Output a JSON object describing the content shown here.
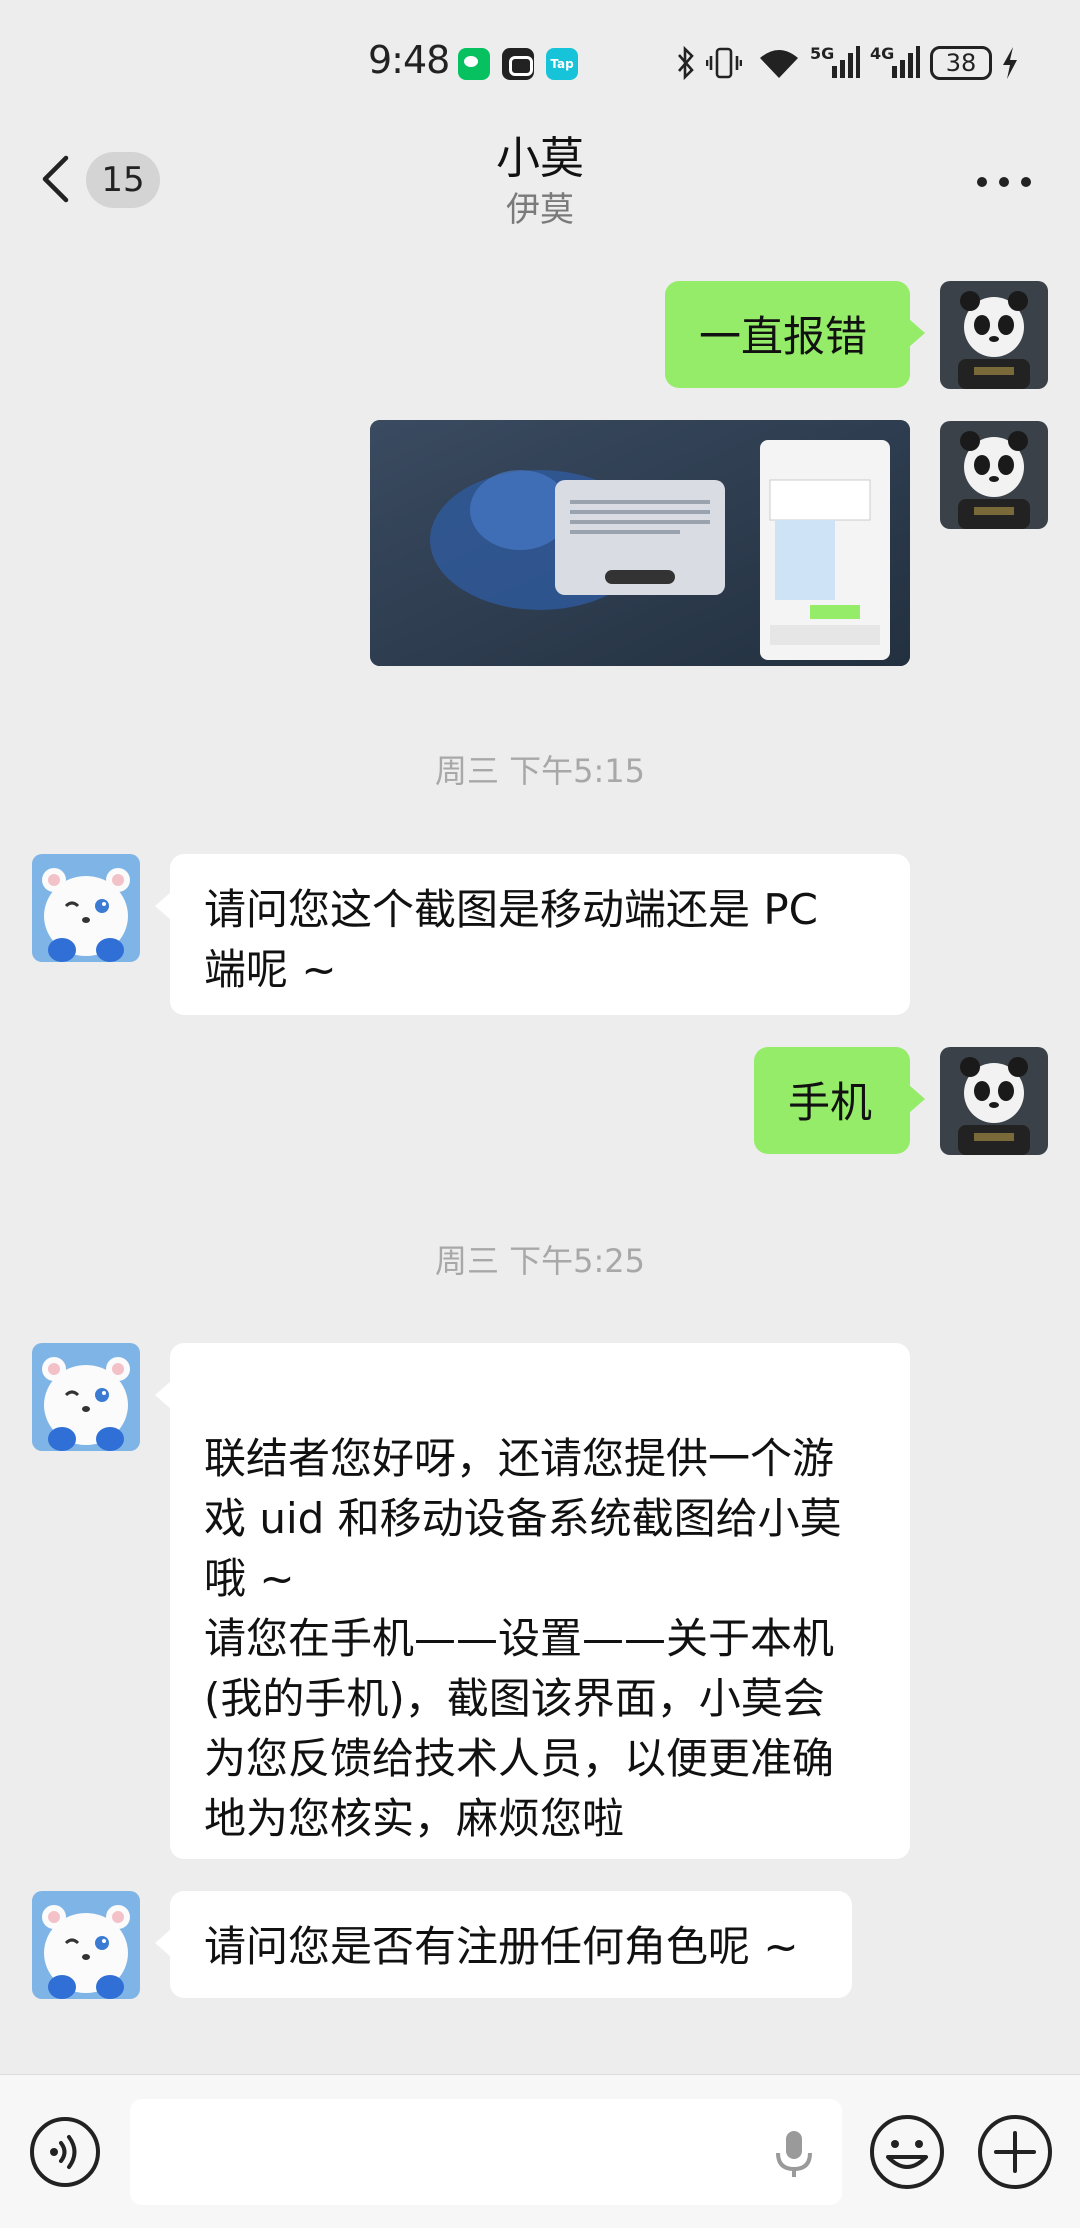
{
  "status_bar": {
    "time": "9:48",
    "battery": "38",
    "network_1": "5G",
    "network_2": "4G"
  },
  "header": {
    "unread_count": "15",
    "title": "小莫",
    "subtitle": "伊莫"
  },
  "messages": [
    {
      "sender": "me",
      "type": "text",
      "text": "一直报错"
    },
    {
      "sender": "me",
      "type": "image",
      "description_icon": "screenshot-thumbnail"
    },
    {
      "type": "timestamp",
      "text": "周三 下午5:15"
    },
    {
      "sender": "other",
      "type": "text",
      "text": "请问您这个截图是移动端还是 PC\n端呢 ~"
    },
    {
      "sender": "me",
      "type": "text",
      "text": "手机"
    },
    {
      "type": "timestamp",
      "text": "周三 下午5:25"
    },
    {
      "sender": "other",
      "type": "text",
      "text": "\n联结者您好呀，还请您提供一个游\n戏 uid 和移动设备系统截图给小莫\n哦 ~\n请您在手机——设置——关于本机\n(我的手机)，截图该界面，小莫会\n为您反馈给技术人员，以便更准确\n地为您核实，麻烦您啦"
    },
    {
      "sender": "other",
      "type": "text",
      "text": "请问您是否有注册任何角色呢 ~"
    }
  ],
  "input_bar": {
    "placeholder": ""
  },
  "colors": {
    "background": "#ededed",
    "my_bubble": "#95ec69",
    "their_bubble": "#ffffff",
    "timestamp": "#a8a8a8"
  }
}
